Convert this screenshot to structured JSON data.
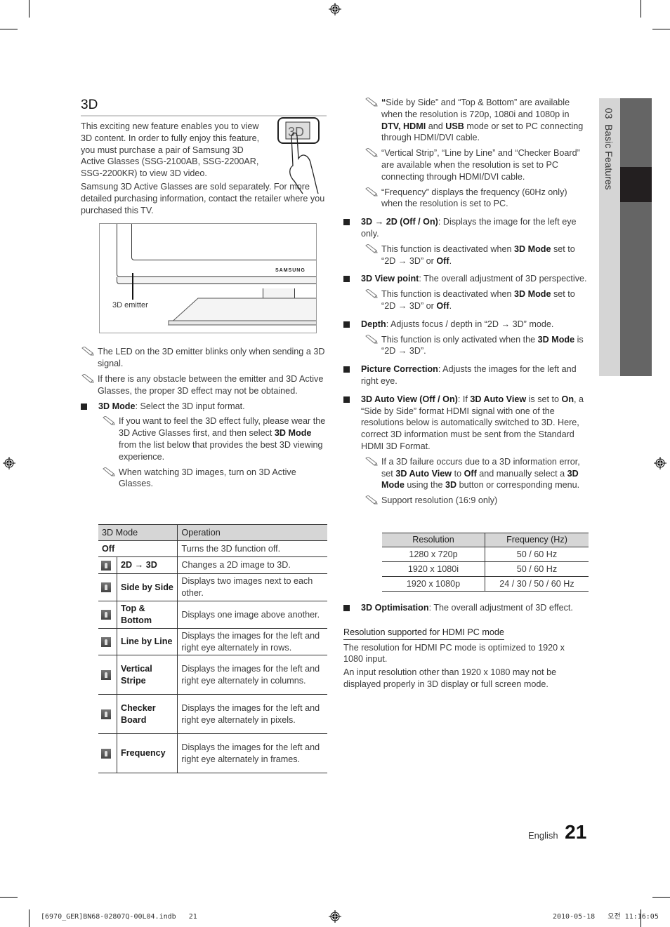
{
  "section_title": "3D",
  "intro": {
    "p1": "This exciting new feature enables you to view 3D content. In order to fully enjoy this feature, you must purchase a pair of Samsung 3D Active Glasses (SSG-2100AB, SSG-2200AR, SSG-2200KR) to view 3D video.",
    "p2": "Samsung 3D Active Glasses are sold separately. For more detailed purchasing information, contact the retailer where you purchased this TV."
  },
  "figure": {
    "brand": "SAMSUNG",
    "emitter_label": "3D emitter"
  },
  "left_notes": [
    "The LED on the 3D emitter blinks only when sending a 3D signal.",
    "If there is any obstacle between the emitter and 3D Active Glasses, the proper 3D effect may not be obtained."
  ],
  "mode_item": {
    "term": "3D Mode",
    "desc": ": Select the 3D input format.",
    "note1_pre": "If you want to feel the 3D effect fully, please wear the 3D Active Glasses first, and then select ",
    "note1_bold": "3D Mode",
    "note1_post": " from the list below that provides the best 3D viewing experience.",
    "note2": "When watching 3D images, turn on 3D Active Glasses."
  },
  "mode_table": {
    "headers": [
      "3D Mode",
      "Operation"
    ],
    "rows": [
      {
        "mode": "Off",
        "op": "Turns the 3D function off.",
        "icon": "none"
      },
      {
        "mode": "2D → 3D",
        "op": "Changes a 2D image to 3D.",
        "icon": "2d-to-3d-icon"
      },
      {
        "mode": "Side by Side",
        "op": "Displays two images next to each other.",
        "icon": "side-by-side-icon"
      },
      {
        "mode": "Top & Bottom",
        "op": "Displays one image above another.",
        "icon": "top-bottom-icon"
      },
      {
        "mode": "Line by Line",
        "op": "Displays the images for the left and right eye alternately in rows.",
        "icon": "line-by-line-icon"
      },
      {
        "mode": "Vertical Stripe",
        "op": "Displays the images for the left and right eye alternately in columns.",
        "icon": "vertical-stripe-icon"
      },
      {
        "mode": "Checker Board",
        "op": "Displays the images for the left and right eye alternately in pixels.",
        "icon": "checker-board-icon"
      },
      {
        "mode": "Frequency",
        "op": "Displays the images for the left and right eye alternately in frames.",
        "icon": "frequency-icon"
      }
    ]
  },
  "right": {
    "note_a": {
      "q1": "“",
      "t1": "Side by Side” and “Top & Bottom” are available when the resolution is 720p, 1080i and 1080p in ",
      "b1": "DTV, HDMI",
      "t2": " and ",
      "b2": "USB",
      "t3": " mode or set to PC connecting through HDMI/DVI cable."
    },
    "note_b": "“Vertical Strip”, “Line by Line” and “Checker Board” are available when the resolution is set to PC connecting through HDMI/DVI cable.",
    "note_c": "“Frequency” displays the frequency (60Hz only) when the resolution is set to PC.",
    "item_3d2d": {
      "term": "3D → 2D (Off / On)",
      "desc": ": Displays the image for the left eye only."
    },
    "deact_note": {
      "t1": "This function is deactivated when ",
      "b1": "3D Mode",
      "t2": " set to “2D → 3D” or ",
      "b2": "Off",
      "t3": "."
    },
    "item_viewpoint": {
      "term": "3D View point",
      "desc": ": The overall adjustment of 3D perspective."
    },
    "item_depth": {
      "term": "Depth",
      "desc": ": Adjusts focus / depth in “2D → 3D” mode."
    },
    "depth_note": {
      "t1": "This function is only activated when the ",
      "b1": "3D Mode",
      "t2": " is “2D → 3D”."
    },
    "item_picture": {
      "term": "Picture Correction",
      "desc": ": Adjusts the images for the left and right eye."
    },
    "item_autoview": {
      "term": "3D Auto View (Off / On)",
      "t1": ": If ",
      "b1": "3D Auto View",
      "t2": " is set to ",
      "b2": "On",
      "t3": ", a “Side by Side” format HDMI signal with one of the resolutions below is automatically switched to 3D. Here, correct 3D information must be sent from the Standard HDMI 3D Format."
    },
    "autoview_note1": {
      "t1": "If a 3D failure occurs due to a 3D information error, set ",
      "b1": "3D Auto View",
      "t2": " to ",
      "b2": "Off",
      "t3": " and manually select a ",
      "b3": "3D Mode",
      "t4": " using the ",
      "b4": "3D",
      "t5": " button or corresponding menu."
    },
    "autoview_note2": "Support resolution (16:9 only)",
    "item_optimisation": {
      "term": "3D Optimisation",
      "desc": ": The overall adjustment of 3D effect."
    },
    "hdmi_pc_heading": "Resolution supported for HDMI PC mode",
    "hdmi_pc_p1": "The resolution for HDMI PC mode is optimized to 1920 x 1080 input.",
    "hdmi_pc_p2": "An input resolution other than 1920 x 1080 may not be displayed properly in 3D display or full screen mode."
  },
  "res_table": {
    "headers": [
      "Resolution",
      "Frequency (Hz)"
    ],
    "rows": [
      [
        "1280 x 720p",
        "50 / 60 Hz"
      ],
      [
        "1920 x 1080i",
        "50 / 60 Hz"
      ],
      [
        "1920 x 1080p",
        "24 / 30 / 50 / 60 Hz"
      ]
    ]
  },
  "side_tab": {
    "chapter": "03",
    "title": "Basic Features"
  },
  "footer": {
    "language": "English",
    "page": "21"
  },
  "print_slug": {
    "file": "[6970_GER]BN68-02807Q-00L04.indb   21",
    "timestamp": "2010-05-18   오전 11:16:05"
  }
}
